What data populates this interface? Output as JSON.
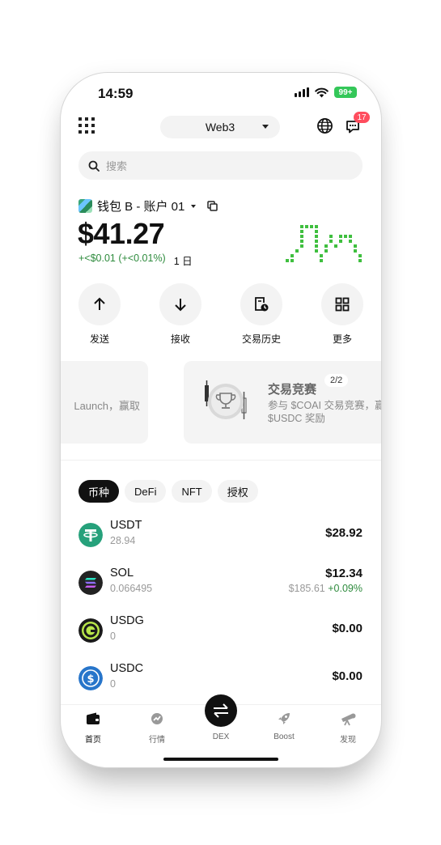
{
  "status": {
    "time": "14:59",
    "battery": "99+"
  },
  "header": {
    "network": "Web3",
    "notification_count": "17"
  },
  "search": {
    "placeholder": "搜索"
  },
  "wallet": {
    "name": "钱包 B - 账户 01",
    "balance": "$41.27",
    "change": "+<$0.01 (+<0.01%)",
    "period": "1 日"
  },
  "actions": [
    {
      "label": "发送",
      "icon": "arrow-up-icon"
    },
    {
      "label": "接收",
      "icon": "arrow-down-icon"
    },
    {
      "label": "交易历史",
      "icon": "history-icon"
    },
    {
      "label": "更多",
      "icon": "grid-icon"
    }
  ],
  "banners": [
    {
      "text": "Launch，赢取"
    },
    {
      "title": "交易竞赛",
      "desc_line1": "参与 $COAI 交易竞赛，赢",
      "desc_line2": "$USDC 奖励",
      "page": "2/2"
    }
  ],
  "tabs": [
    "币种",
    "DeFi",
    "NFT",
    "授权"
  ],
  "assets": [
    {
      "symbol": "USDT",
      "amount": "28.94",
      "value": "$28.92",
      "price": "",
      "change": "",
      "color": "#26a17b"
    },
    {
      "symbol": "SOL",
      "amount": "0.066495",
      "value": "$12.34",
      "price": "$185.61",
      "change": "+0.09%",
      "color": "#222222"
    },
    {
      "symbol": "USDG",
      "amount": "0",
      "value": "$0.00",
      "price": "",
      "change": "",
      "color": "#1a1a1a"
    },
    {
      "symbol": "USDC",
      "amount": "0",
      "value": "$0.00",
      "price": "",
      "change": "",
      "color": "#2775ca"
    }
  ],
  "nav": [
    {
      "label": "首页",
      "icon": "wallet-icon"
    },
    {
      "label": "行情",
      "icon": "market-icon"
    },
    {
      "label": "DEX",
      "icon": "swap-icon"
    },
    {
      "label": "Boost",
      "icon": "rocket-icon"
    },
    {
      "label": "发现",
      "icon": "telescope-icon"
    }
  ],
  "colors": {
    "positive": "#2e8b3d",
    "badge": "#ff4d5e",
    "battery": "#34c759"
  }
}
